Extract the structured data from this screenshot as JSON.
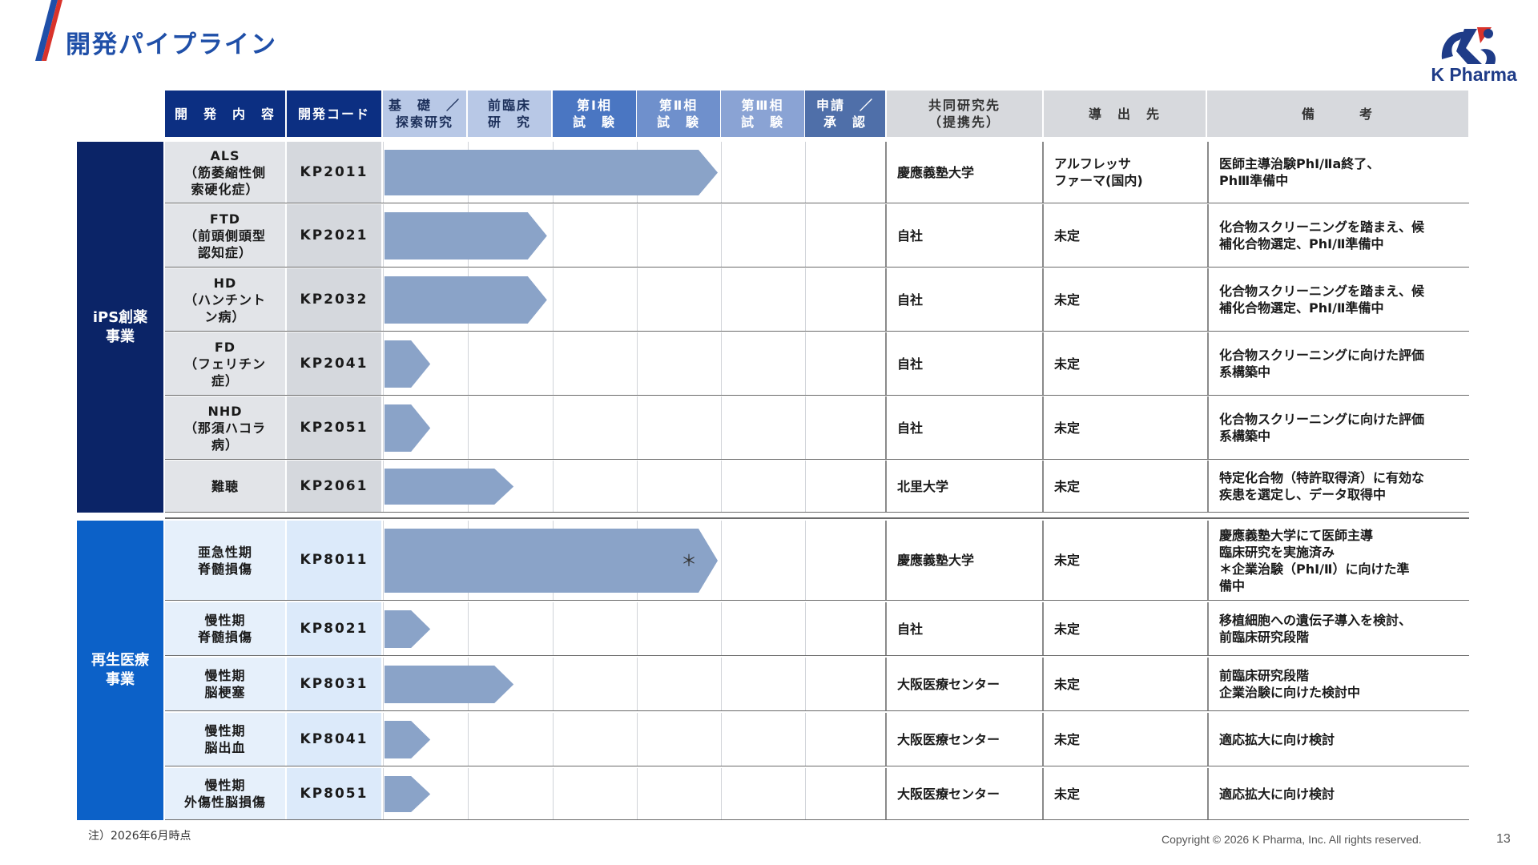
{
  "title": "開発パイプライン",
  "brand": {
    "name": "K Pharma",
    "accent": "#1f4fa8",
    "dark": "#0b2467"
  },
  "headers": [
    {
      "key": "name",
      "label": "開　発　内　容"
    },
    {
      "key": "code",
      "label": "開発コード"
    },
    {
      "key": "s1",
      "label": "基　礎　／\n探索研究"
    },
    {
      "key": "s2",
      "label": "前臨床\n研　究"
    },
    {
      "key": "s3",
      "label": "第Ⅰ相\n試　験"
    },
    {
      "key": "s4",
      "label": "第Ⅱ相\n試　験"
    },
    {
      "key": "s5",
      "label": "第Ⅲ相\n試　験"
    },
    {
      "key": "s6",
      "label": "申請　／\n承　認"
    },
    {
      "key": "partner",
      "label": "共同研究先\n（提携先）"
    },
    {
      "key": "licensee",
      "label": "導　出　先"
    },
    {
      "key": "notes",
      "label": "備　　　考"
    }
  ],
  "groups": [
    {
      "label": "iPS創薬\n事業"
    },
    {
      "label": "再生医療\n事業"
    }
  ],
  "rows": [
    {
      "group": 0,
      "name": "ALS\n（筋萎縮性側\n索硬化症）",
      "code": "KP2011",
      "progress": 4.0,
      "star": false,
      "partner": "慶應義塾大学",
      "licensee": "アルフレッサ\nファーマ(国内)",
      "notes": "医師主導治験PhⅠ/Ⅱa終了、\nPhⅢ準備中"
    },
    {
      "group": 0,
      "name": "FTD\n（前頭側頭型\n認知症）",
      "code": "KP2021",
      "progress": 1.95,
      "star": false,
      "partner": "自社",
      "licensee": "未定",
      "notes": "化合物スクリーニングを踏まえ、候\n補化合物選定、PhⅠ/Ⅱ準備中"
    },
    {
      "group": 0,
      "name": "HD\n（ハンチント\nン病）",
      "code": "KP2032",
      "progress": 1.95,
      "star": false,
      "partner": "自社",
      "licensee": "未定",
      "notes": "化合物スクリーニングを踏まえ、候\n補化合物選定、PhⅠ/Ⅱ準備中"
    },
    {
      "group": 0,
      "name": "FD\n（フェリチン\n症）",
      "code": "KP2041",
      "progress": 0.55,
      "star": false,
      "partner": "自社",
      "licensee": "未定",
      "notes": "化合物スクリーニングに向けた評価\n系構築中"
    },
    {
      "group": 0,
      "name": "NHD\n（那須ハコラ\n病）",
      "code": "KP2051",
      "progress": 0.55,
      "star": false,
      "partner": "自社",
      "licensee": "未定",
      "notes": "化合物スクリーニングに向けた評価\n系構築中"
    },
    {
      "group": 0,
      "name": "難聴",
      "code": "KP2061",
      "progress": 1.55,
      "star": false,
      "partner": "北里大学",
      "licensee": "未定",
      "notes": "特定化合物（特許取得済）に有効な\n疾患を選定し、データ取得中"
    },
    {
      "group": 1,
      "name": "亜急性期\n脊髄損傷",
      "code": "KP8011",
      "progress": 4.0,
      "star": true,
      "partner": "慶應義塾大学",
      "licensee": "未定",
      "notes": "慶應義塾大学にて医師主導\n臨床研究を実施済み\n＊企業治験（PhⅠ/Ⅱ）に向けた準\n備中"
    },
    {
      "group": 1,
      "name": "慢性期\n脊髄損傷",
      "code": "KP8021",
      "progress": 0.55,
      "star": false,
      "partner": "自社",
      "licensee": "未定",
      "notes": "移植細胞への遺伝子導入を検討、\n前臨床研究段階"
    },
    {
      "group": 1,
      "name": "慢性期\n脳梗塞",
      "code": "KP8031",
      "progress": 1.55,
      "star": false,
      "partner": "大阪医療センター",
      "licensee": "未定",
      "notes": "前臨床研究段階\n企業治験に向けた検討中"
    },
    {
      "group": 1,
      "name": "慢性期\n脳出血",
      "code": "KP8041",
      "progress": 0.55,
      "star": false,
      "partner": "大阪医療センター",
      "licensee": "未定",
      "notes": "適応拡大に向け検討"
    },
    {
      "group": 1,
      "name": "慢性期\n外傷性脳損傷",
      "code": "KP8051",
      "progress": 0.55,
      "star": false,
      "partner": "大阪医療センター",
      "licensee": "未定",
      "notes": "適応拡大に向け検討"
    }
  ],
  "star_mark": "＊",
  "footnote": "注）2026年6月時点",
  "copyright": "Copyright © 2026 K Pharma, Inc. All rights reserved.",
  "page_number": "13"
}
